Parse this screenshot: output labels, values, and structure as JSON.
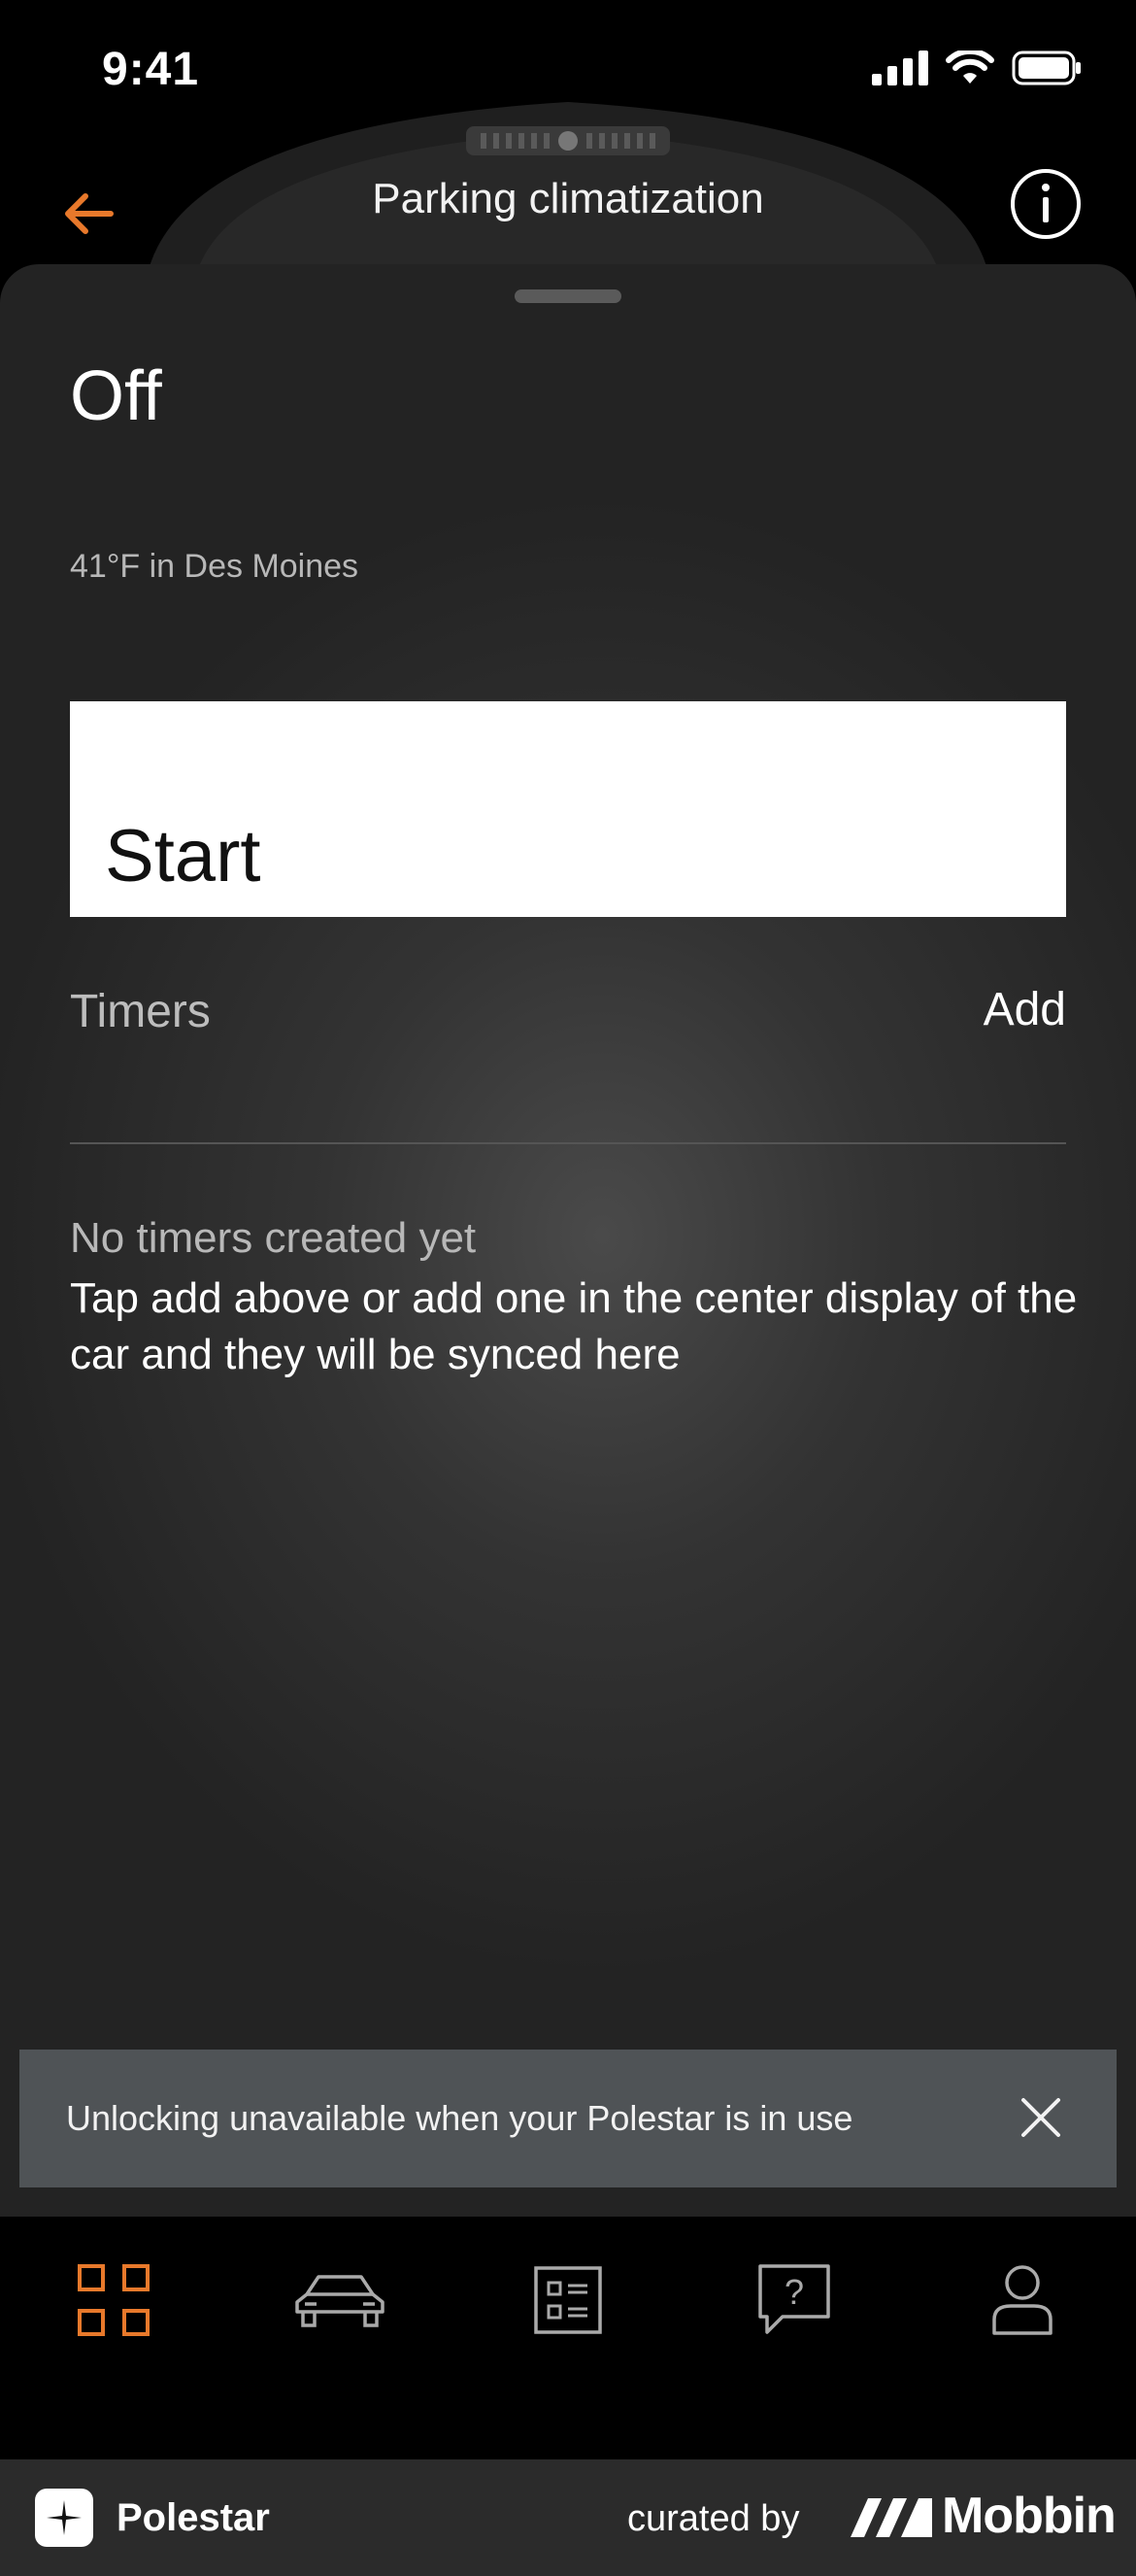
{
  "status_bar": {
    "time": "9:41"
  },
  "header": {
    "title": "Parking climatization"
  },
  "climate": {
    "state": "Off",
    "temperature_text": "41°F in Des Moines",
    "start_label": "Start"
  },
  "timers": {
    "label": "Timers",
    "add_label": "Add",
    "empty_title": "No timers created yet",
    "empty_body": "Tap add above or add one in the center display of the car and they will be synced here"
  },
  "toast": {
    "message": "Unlocking unavailable when your Polestar is in use"
  },
  "tabbar": {
    "active_color": "#e8792b",
    "items": [
      {
        "icon": "grid-icon",
        "active": true
      },
      {
        "icon": "car-icon",
        "active": false
      },
      {
        "icon": "list-icon",
        "active": false
      },
      {
        "icon": "help-icon",
        "active": false
      },
      {
        "icon": "profile-icon",
        "active": false
      }
    ]
  },
  "footer": {
    "app_name": "Polestar",
    "curated_by": "curated by",
    "brand": "Mobbin"
  },
  "colors": {
    "accent": "#e8792b",
    "toast_bg": "#4f5356"
  }
}
